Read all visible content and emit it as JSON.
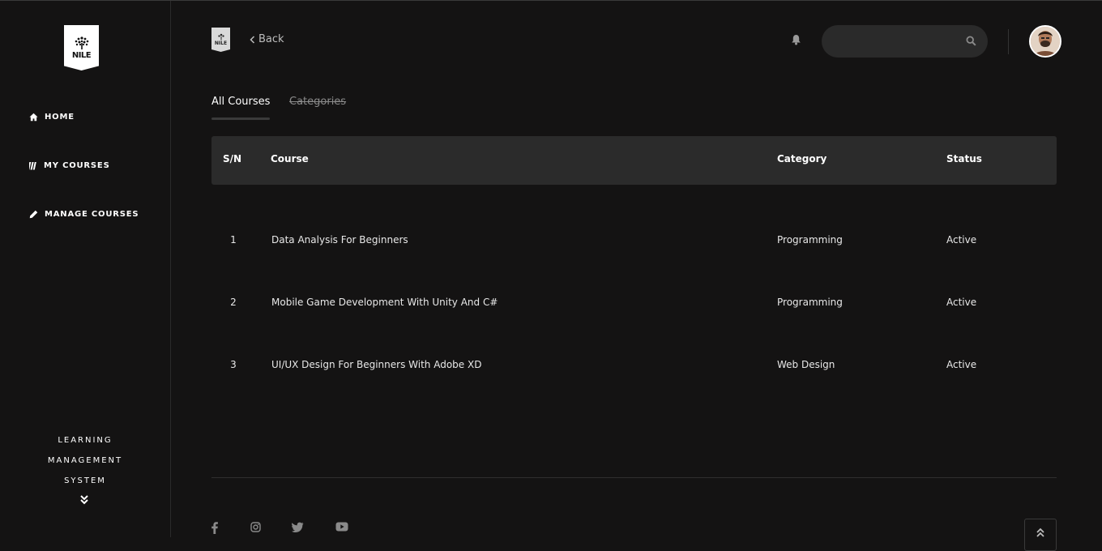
{
  "logo": {
    "text": "NILE",
    "mini_text": "NILE"
  },
  "sidebar": {
    "items": [
      {
        "label": "HOME",
        "icon": "home-icon"
      },
      {
        "label": "MY COURSES",
        "icon": "books-icon"
      },
      {
        "label": "MANAGE COURSES",
        "icon": "pencil-icon"
      }
    ],
    "brand_lines": [
      "LEARNING",
      "MANAGEMENT",
      "SYSTEM"
    ]
  },
  "header": {
    "back_label": "Back",
    "search_placeholder": ""
  },
  "tabs": [
    {
      "label": "All Courses",
      "active": true
    },
    {
      "label": "Categories",
      "active": false
    }
  ],
  "table": {
    "columns": [
      "S/N",
      "Course",
      "Category",
      "Status"
    ],
    "rows": [
      {
        "sn": "1",
        "course": "Data Analysis For Beginners",
        "category": "Programming",
        "status": "Active"
      },
      {
        "sn": "2",
        "course": "Mobile Game Development With Unity And C#",
        "category": "Programming",
        "status": "Active"
      },
      {
        "sn": "3",
        "course": "UI/UX Design For Beginners With Adobe XD",
        "category": "Web Design",
        "status": "Active"
      }
    ]
  },
  "footer": {
    "social": [
      "facebook-icon",
      "instagram-icon",
      "twitter-icon",
      "youtube-icon"
    ]
  },
  "colors": {
    "background": "#141313",
    "header_row": "#2b2b2b",
    "search_bg": "#2a2a2a",
    "text": "#ffffff"
  }
}
